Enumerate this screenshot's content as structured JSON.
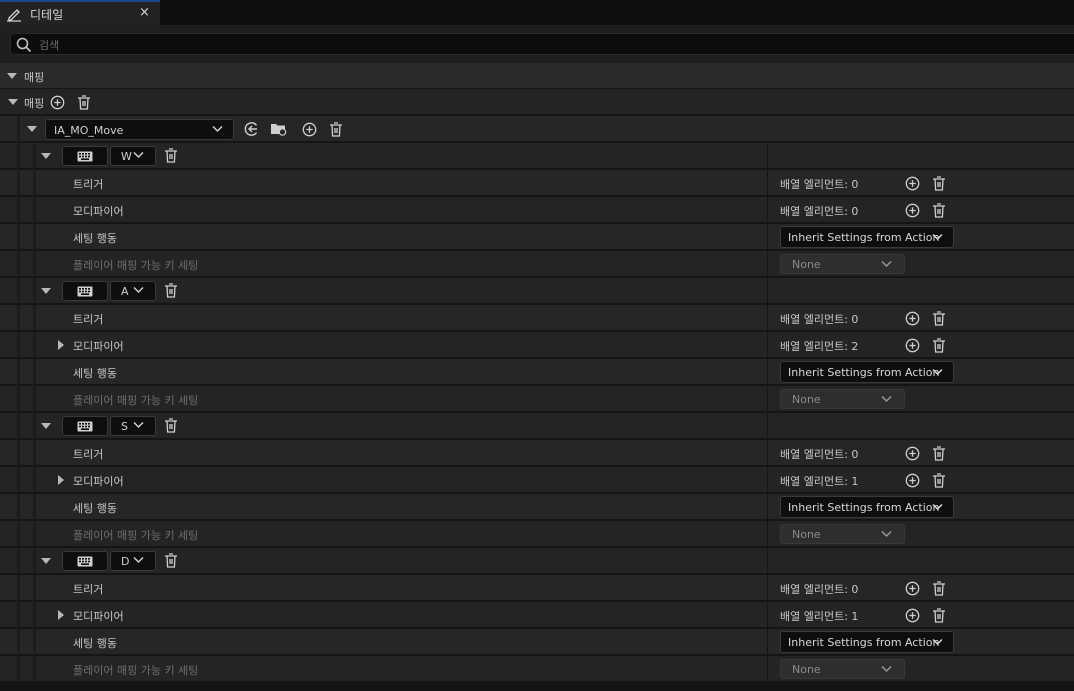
{
  "tab": {
    "title": "디테일",
    "close_label": "×"
  },
  "search": {
    "placeholder": "검색"
  },
  "section": {
    "title": "매핑"
  },
  "mappings_row": {
    "label": "매핑"
  },
  "action": {
    "name": "IA_MO_Move"
  },
  "labels": {
    "triggers": "트리거",
    "modifiers": "모디파이어",
    "setting_behavior": "세팅 행동",
    "player_mappable": "플레이어 매핑 가능 키 세팅",
    "inherit": "Inherit Settings from Action",
    "none": "None"
  },
  "keys": [
    {
      "key": "W",
      "triggers_count": "배열 엘리먼트: 0",
      "modifiers_count": "배열 엘리먼트: 0",
      "modifiers_expandable": false
    },
    {
      "key": "A",
      "triggers_count": "배열 엘리먼트: 0",
      "modifiers_count": "배열 엘리먼트: 2",
      "modifiers_expandable": true
    },
    {
      "key": "S",
      "triggers_count": "배열 엘리먼트: 0",
      "modifiers_count": "배열 엘리먼트: 1",
      "modifiers_expandable": true
    },
    {
      "key": "D",
      "triggers_count": "배열 엘리먼트: 0",
      "modifiers_count": "배열 엘리먼트: 1",
      "modifiers_expandable": true
    }
  ],
  "icons": {
    "tab": "edit-details-icon",
    "search": "search-icon",
    "add": "plus-circle-icon",
    "delete": "trash-icon",
    "browse": "arrow-left-circle-icon",
    "find_in_browser": "folder-search-icon",
    "keyboard": "keyboard-icon",
    "expand": "caret-down-icon",
    "collapsed": "caret-right-icon"
  }
}
